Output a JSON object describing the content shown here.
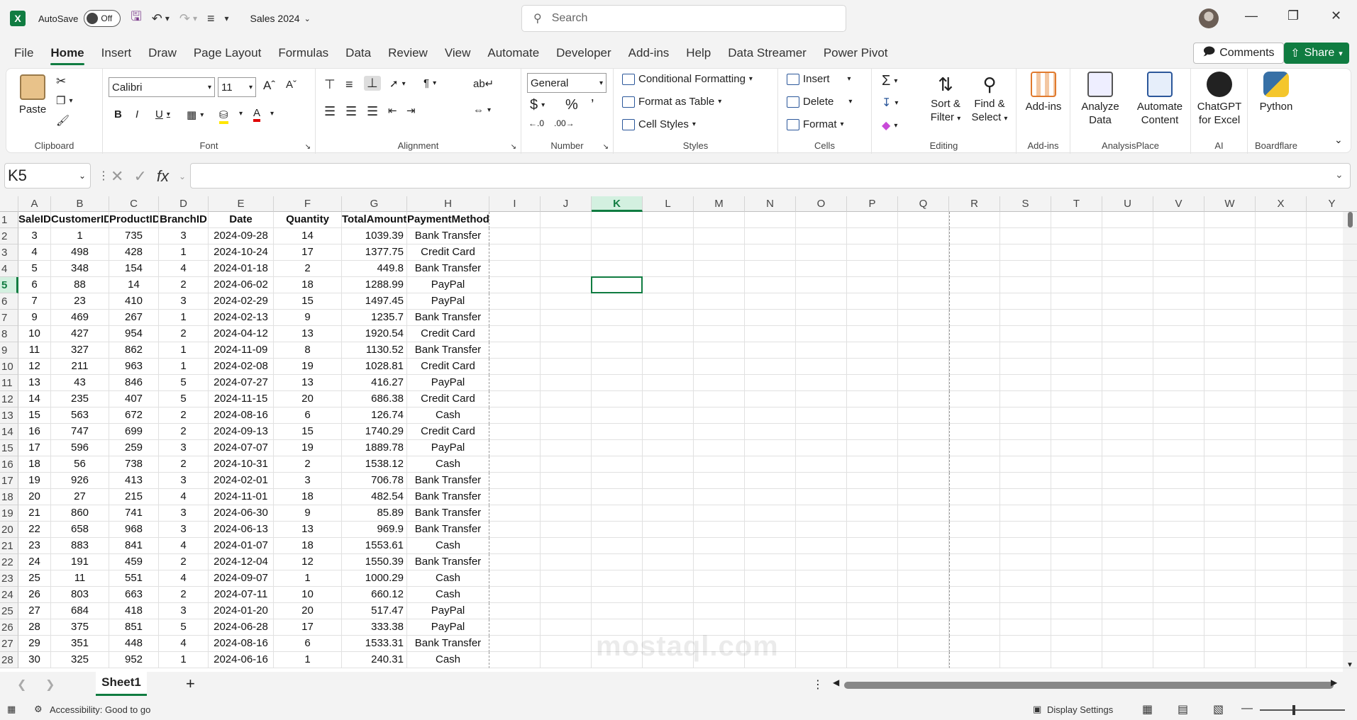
{
  "titlebar": {
    "app_logo": "X",
    "autosave_label": "AutoSave",
    "autosave_state": "Off",
    "doc_title": "Sales 2024",
    "search_placeholder": "Search"
  },
  "tabs": [
    "File",
    "Home",
    "Insert",
    "Draw",
    "Page Layout",
    "Formulas",
    "Data",
    "Review",
    "View",
    "Automate",
    "Developer",
    "Add-ins",
    "Help",
    "Data Streamer",
    "Power Pivot"
  ],
  "active_tab": "Home",
  "header_buttons": {
    "comments": "Comments",
    "share": "Share"
  },
  "ribbon": {
    "clipboard": {
      "label": "Clipboard",
      "paste": "Paste"
    },
    "font": {
      "label": "Font",
      "font_name": "Calibri",
      "font_size": "11"
    },
    "alignment": {
      "label": "Alignment"
    },
    "number": {
      "label": "Number",
      "format": "General"
    },
    "styles": {
      "label": "Styles",
      "conditional": "Conditional Formatting",
      "format_table": "Format as Table",
      "cell_styles": "Cell Styles"
    },
    "cells": {
      "label": "Cells",
      "insert": "Insert",
      "delete": "Delete",
      "format": "Format"
    },
    "editing": {
      "label": "Editing",
      "sort_filter_1": "Sort &",
      "sort_filter_2": "Filter",
      "find_select_1": "Find &",
      "find_select_2": "Select"
    },
    "addins": {
      "label": "Add-ins",
      "button": "Add-ins"
    },
    "analysis": {
      "label": "AnalysisPlace",
      "analyze_1": "Analyze",
      "analyze_2": "Data",
      "automate_1": "Automate",
      "automate_2": "Content"
    },
    "ai": {
      "label": "AI",
      "chatgpt_1": "ChatGPT",
      "chatgpt_2": "for Excel"
    },
    "boardflare": {
      "label": "Boardflare",
      "python": "Python"
    }
  },
  "formula_bar": {
    "name_box": "K5",
    "content": ""
  },
  "columns": [
    "A",
    "B",
    "C",
    "D",
    "E",
    "F",
    "G",
    "H",
    "I",
    "J",
    "K",
    "L",
    "M",
    "N",
    "O",
    "P",
    "Q",
    "R",
    "S",
    "T",
    "U",
    "V",
    "W",
    "X",
    "Y"
  ],
  "table_headers": [
    "SaleID",
    "CustomerID",
    "ProductID",
    "BranchID",
    "Date",
    "Quantity",
    "TotalAmount",
    "PaymentMethod"
  ],
  "rows": [
    [
      "3",
      "1",
      "735",
      "3",
      "2024-09-28",
      "14",
      "1039.39",
      "Bank Transfer"
    ],
    [
      "4",
      "498",
      "428",
      "1",
      "2024-10-24",
      "17",
      "1377.75",
      "Credit Card"
    ],
    [
      "5",
      "348",
      "154",
      "4",
      "2024-01-18",
      "2",
      "449.8",
      "Bank Transfer"
    ],
    [
      "6",
      "88",
      "14",
      "2",
      "2024-06-02",
      "18",
      "1288.99",
      "PayPal"
    ],
    [
      "7",
      "23",
      "410",
      "3",
      "2024-02-29",
      "15",
      "1497.45",
      "PayPal"
    ],
    [
      "9",
      "469",
      "267",
      "1",
      "2024-02-13",
      "9",
      "1235.7",
      "Bank Transfer"
    ],
    [
      "10",
      "427",
      "954",
      "2",
      "2024-04-12",
      "13",
      "1920.54",
      "Credit Card"
    ],
    [
      "11",
      "327",
      "862",
      "1",
      "2024-11-09",
      "8",
      "1130.52",
      "Bank Transfer"
    ],
    [
      "12",
      "211",
      "963",
      "1",
      "2024-02-08",
      "19",
      "1028.81",
      "Credit Card"
    ],
    [
      "13",
      "43",
      "846",
      "5",
      "2024-07-27",
      "13",
      "416.27",
      "PayPal"
    ],
    [
      "14",
      "235",
      "407",
      "5",
      "2024-11-15",
      "20",
      "686.38",
      "Credit Card"
    ],
    [
      "15",
      "563",
      "672",
      "2",
      "2024-08-16",
      "6",
      "126.74",
      "Cash"
    ],
    [
      "16",
      "747",
      "699",
      "2",
      "2024-09-13",
      "15",
      "1740.29",
      "Credit Card"
    ],
    [
      "17",
      "596",
      "259",
      "3",
      "2024-07-07",
      "19",
      "1889.78",
      "PayPal"
    ],
    [
      "18",
      "56",
      "738",
      "2",
      "2024-10-31",
      "2",
      "1538.12",
      "Cash"
    ],
    [
      "19",
      "926",
      "413",
      "3",
      "2024-02-01",
      "3",
      "706.78",
      "Bank Transfer"
    ],
    [
      "20",
      "27",
      "215",
      "4",
      "2024-11-01",
      "18",
      "482.54",
      "Bank Transfer"
    ],
    [
      "21",
      "860",
      "741",
      "3",
      "2024-06-30",
      "9",
      "85.89",
      "Bank Transfer"
    ],
    [
      "22",
      "658",
      "968",
      "3",
      "2024-06-13",
      "13",
      "969.9",
      "Bank Transfer"
    ],
    [
      "23",
      "883",
      "841",
      "4",
      "2024-01-07",
      "18",
      "1553.61",
      "Cash"
    ],
    [
      "24",
      "191",
      "459",
      "2",
      "2024-12-04",
      "12",
      "1550.39",
      "Bank Transfer"
    ],
    [
      "25",
      "11",
      "551",
      "4",
      "2024-09-07",
      "1",
      "1000.29",
      "Cash"
    ],
    [
      "26",
      "803",
      "663",
      "2",
      "2024-07-11",
      "10",
      "660.12",
      "Cash"
    ],
    [
      "27",
      "684",
      "418",
      "3",
      "2024-01-20",
      "20",
      "517.47",
      "PayPal"
    ],
    [
      "28",
      "375",
      "851",
      "5",
      "2024-06-28",
      "17",
      "333.38",
      "PayPal"
    ],
    [
      "29",
      "351",
      "448",
      "4",
      "2024-08-16",
      "6",
      "1533.31",
      "Bank Transfer"
    ],
    [
      "30",
      "325",
      "952",
      "1",
      "2024-06-16",
      "1",
      "240.31",
      "Cash"
    ]
  ],
  "sheet_tabs": [
    "Sheet1"
  ],
  "status": {
    "accessibility": "Accessibility: Good to go",
    "display_settings": "Display Settings"
  },
  "watermark": {
    "latin": "mostaql.com"
  },
  "colors": {
    "brand": "#107c41",
    "selection": "#d3f0e0"
  }
}
